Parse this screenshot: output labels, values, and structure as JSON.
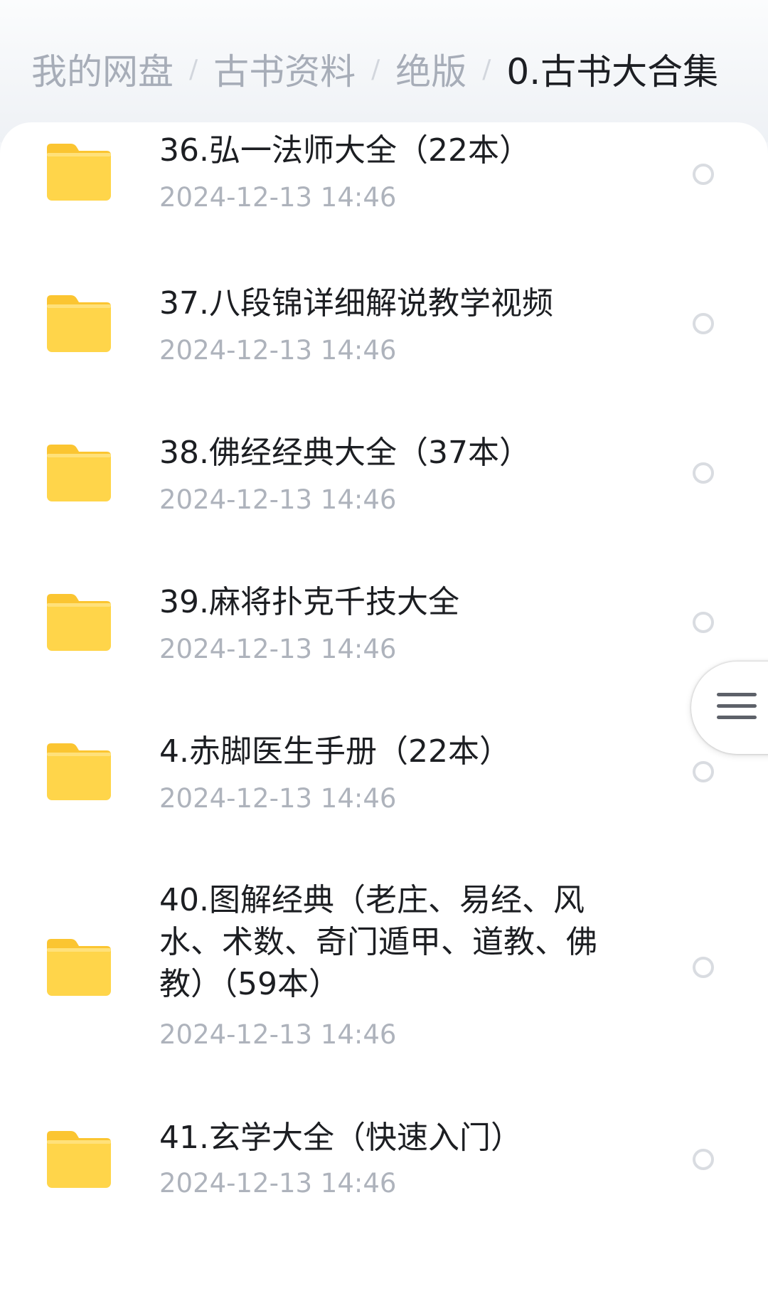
{
  "breadcrumb": {
    "items": [
      "我的网盘",
      "古书资料",
      "绝版",
      "0.古书大合集"
    ],
    "separator": "/"
  },
  "colors": {
    "folder": "#ffd54a",
    "folder_tab": "#fbc531",
    "title": "#1c1e22",
    "date": "#aeb3bc",
    "breadcrumb_inactive": "#a7adb8"
  },
  "files": [
    {
      "name": "36.弘一法师大全（22本）",
      "date": "2024-12-13  14:46",
      "icon": "folder-icon"
    },
    {
      "name": "37.八段锦详细解说教学视频",
      "date": "2024-12-13  14:46",
      "icon": "folder-icon"
    },
    {
      "name": "38.佛经经典大全（37本）",
      "date": "2024-12-13  14:46",
      "icon": "folder-icon"
    },
    {
      "name": "39.麻将扑克千技大全",
      "date": "2024-12-13  14:46",
      "icon": "folder-icon"
    },
    {
      "name": "4.赤脚医生手册（22本）",
      "date": "2024-12-13  14:46",
      "icon": "folder-icon"
    },
    {
      "name": "40.图解经典（老庄、易经、风水、术数、奇门遁甲、道教、佛教）（59本）",
      "date": "2024-12-13  14:46",
      "icon": "folder-icon"
    },
    {
      "name": "41.玄学大全（快速入门）",
      "date": "2024-12-13  14:46",
      "icon": "folder-icon"
    }
  ],
  "float_menu": {
    "icon": "menu-icon"
  }
}
